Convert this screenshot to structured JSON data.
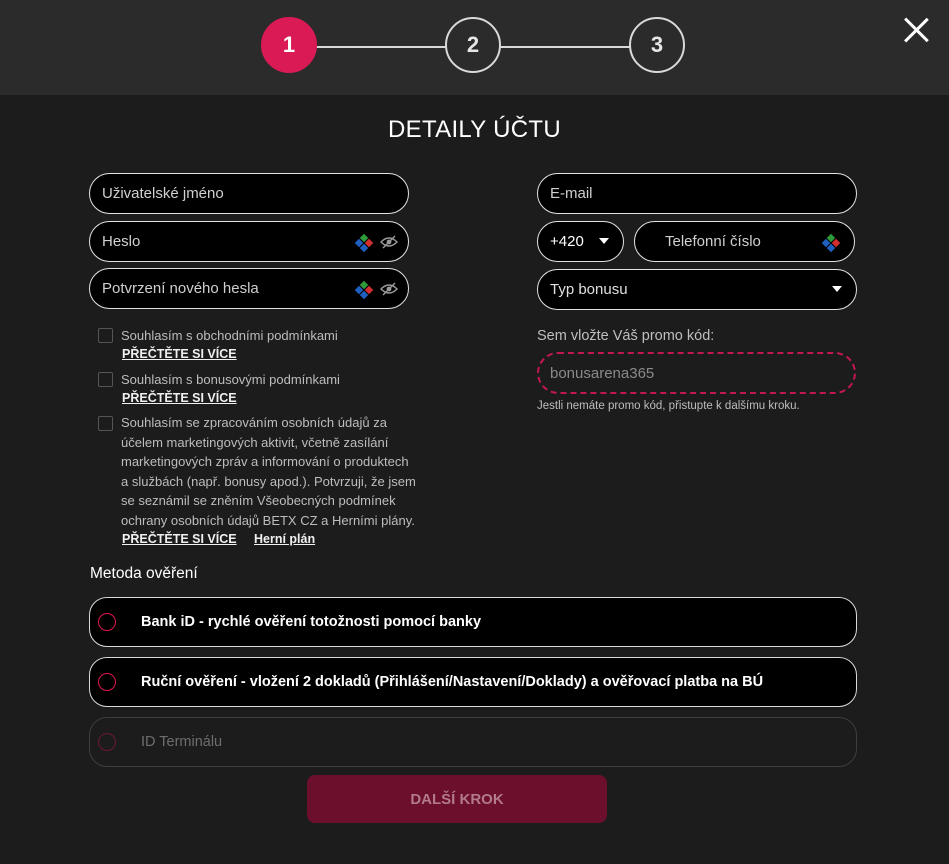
{
  "stepper": {
    "steps": [
      "1",
      "2",
      "3"
    ],
    "active": 1
  },
  "title": "DETAILY ÚČTU",
  "left_form": {
    "username_placeholder": "Uživatelské jméno",
    "password_placeholder": "Heslo",
    "confirm_password_placeholder": "Potvrzení nového hesla"
  },
  "right_form": {
    "email_placeholder": "E-mail",
    "phone_prefix": "+420",
    "phone_placeholder": "Telefonní číslo",
    "bonus_type_placeholder": "Typ bonusu",
    "promo_label": "Sem vložte Váš promo kód:",
    "promo_placeholder": "bonusarena365",
    "promo_hint": "Jestli nemáte promo kód, přistupte k dalšímu kroku."
  },
  "consents": [
    {
      "text": "Souhlasím s obchodními podmínkami",
      "link": "PŘEČTĚTE SI VÍCE"
    },
    {
      "text": "Souhlasím s bonusovými podmínkami",
      "link": "PŘEČTĚTE SI VÍCE"
    },
    {
      "lines": [
        "Souhlasím se zpracováním osobních údajů za",
        "účelem marketingových aktivit, včetně zasílání",
        "marketingových zpráv a informování o produktech",
        "a službách (např. bonusy apod.). Potvrzuji, že jsem",
        "se seznámil se zněním Všeobecných podmínek",
        "ochrany osobních údajů BETX CZ a Herními plány."
      ],
      "link": "PŘEČTĚTE SI VÍCE",
      "link2": "Herní plán"
    }
  ],
  "verification": {
    "title": "Metoda ověření",
    "options": [
      "Bank iD - rychlé ověření totožnosti pomocí banky",
      "Ruční ověření - vložení 2 dokladů (Přihlášení/Nastavení/Doklady) a ověřovací platba na BÚ",
      "ID Terminálu"
    ]
  },
  "next_button": "DALŠÍ KROK",
  "colors": {
    "accent": "#d91a55",
    "button_bg": "#6b0f2c",
    "panel_bg": "#1c1c1c",
    "header_bg": "#2b2b2b"
  },
  "icons": [
    "close-icon",
    "keypad-icon",
    "eye-off-icon",
    "chevron-down-icon",
    "radio-icon"
  ]
}
